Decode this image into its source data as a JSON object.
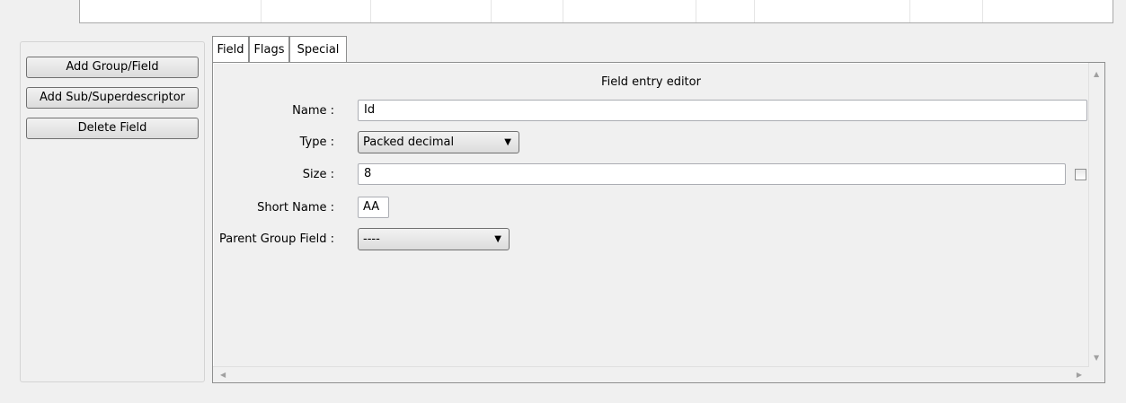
{
  "buttons": {
    "add_group_field": "Add Group/Field",
    "add_sub_superdescriptor": "Add Sub/Superdescriptor",
    "delete_field": "Delete Field"
  },
  "tabs": [
    {
      "label": "Field",
      "active": true
    },
    {
      "label": "Flags",
      "active": false
    },
    {
      "label": "Special",
      "active": false
    }
  ],
  "editor": {
    "title": "Field entry editor",
    "name_label": "Name :",
    "name_value": "Id",
    "type_label": "Type :",
    "type_value": "Packed decimal",
    "size_label": "Size :",
    "size_value": "8",
    "size_checkbox_checked": false,
    "short_name_label": "Short Name :",
    "short_name_value": "AA",
    "parent_label": "Parent Group Field :",
    "parent_value": "----"
  },
  "icons": {
    "dropdown": "▼",
    "scroll_up": "▲",
    "scroll_down": "▼",
    "scroll_left": "◀",
    "scroll_right": "▶"
  }
}
